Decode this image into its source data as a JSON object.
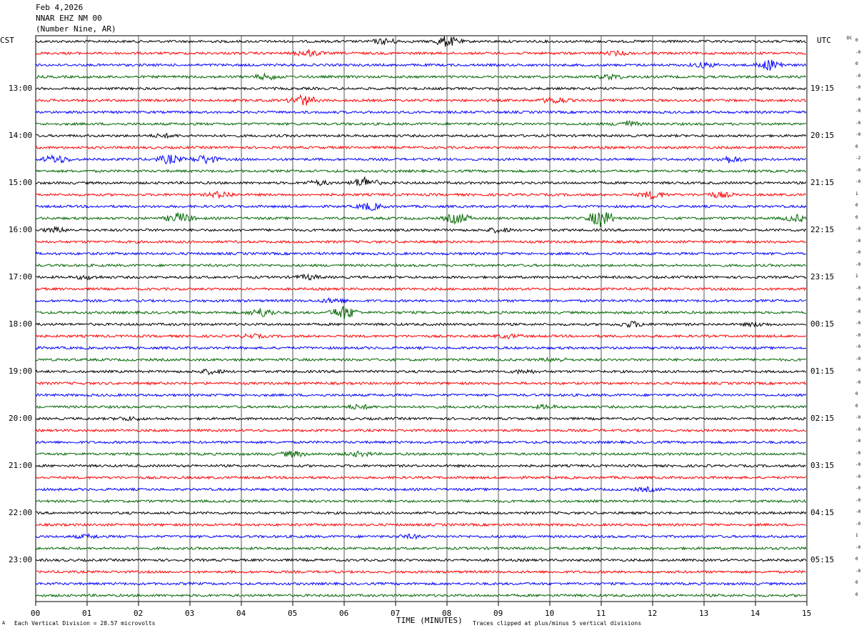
{
  "header": {
    "date": "Feb 4,2026",
    "station": "NNAR EHZ NM 00",
    "location": "(Number Nine, AR)"
  },
  "left_tz": "CST",
  "right_tz": "UTC",
  "dc_label": "DC",
  "footer": {
    "left": "Each Vertical Division =   28.57 microvolts",
    "right": "Traces clipped at plus/minus 5 vertical divisions",
    "corner": "A"
  },
  "chart_data": {
    "type": "line",
    "title": "",
    "xlabel": "TIME (MINUTES)",
    "xlim": [
      0,
      15
    ],
    "x_ticks": [
      "00",
      "01",
      "02",
      "03",
      "04",
      "05",
      "06",
      "07",
      "08",
      "09",
      "10",
      "11",
      "12",
      "13",
      "14",
      "15"
    ],
    "trace_count": 48,
    "trace_interval_minutes": 15,
    "trace_colors": [
      "#000000",
      "#ff0000",
      "#0000ff",
      "#006600"
    ],
    "left_time_labels": [
      {
        "trace": 4,
        "label": "13:00"
      },
      {
        "trace": 8,
        "label": "14:00"
      },
      {
        "trace": 12,
        "label": "15:00"
      },
      {
        "trace": 16,
        "label": "16:00"
      },
      {
        "trace": 20,
        "label": "17:00"
      },
      {
        "trace": 24,
        "label": "18:00"
      },
      {
        "trace": 28,
        "label": "19:00"
      },
      {
        "trace": 32,
        "label": "20:00"
      },
      {
        "trace": 36,
        "label": "21:00"
      },
      {
        "trace": 40,
        "label": "22:00"
      },
      {
        "trace": 44,
        "label": "23:00"
      }
    ],
    "right_time_labels": [
      {
        "trace": 4,
        "label": "19:15"
      },
      {
        "trace": 8,
        "label": "20:15"
      },
      {
        "trace": 12,
        "label": "21:15"
      },
      {
        "trace": 16,
        "label": "22:15"
      },
      {
        "trace": 20,
        "label": "23:15"
      },
      {
        "trace": 24,
        "label": "00:15"
      },
      {
        "trace": 28,
        "label": "01:15"
      },
      {
        "trace": 32,
        "label": "02:15"
      },
      {
        "trace": 36,
        "label": "03:15"
      },
      {
        "trace": 40,
        "label": "04:15"
      },
      {
        "trace": 44,
        "label": "05:15"
      }
    ],
    "dc_offsets": [
      "0",
      "-0",
      "0",
      "-0",
      "-0",
      "-0",
      "-0",
      "-0",
      "-0",
      "0",
      "-2",
      "-0",
      "-0",
      "1",
      "0",
      "0",
      "-0",
      "-0",
      "-0",
      "-0",
      "1",
      "-0",
      "-0",
      "-0",
      "-0",
      "-0",
      "-0",
      "-0",
      "-0",
      "-0",
      "0",
      "0",
      "-0",
      "-0",
      "-0",
      "-0",
      "-0",
      "-0",
      "-0",
      "-0",
      "-0",
      "-0",
      "1",
      "-0",
      "0",
      "-0",
      "0",
      "0"
    ],
    "events": [
      {
        "trace": 0,
        "minute": 8.0,
        "amp": 1.0
      },
      {
        "trace": 0,
        "minute": 6.8,
        "amp": 0.5
      },
      {
        "trace": 1,
        "minute": 5.3,
        "amp": 0.6
      },
      {
        "trace": 1,
        "minute": 11.3,
        "amp": 0.3
      },
      {
        "trace": 2,
        "minute": 14.3,
        "amp": 1.0
      },
      {
        "trace": 2,
        "minute": 13.0,
        "amp": 0.4
      },
      {
        "trace": 3,
        "minute": 4.5,
        "amp": 0.5
      },
      {
        "trace": 3,
        "minute": 11.2,
        "amp": 0.4
      },
      {
        "trace": 5,
        "minute": 5.2,
        "amp": 1.0
      },
      {
        "trace": 5,
        "minute": 10.1,
        "amp": 0.6
      },
      {
        "trace": 7,
        "minute": 11.5,
        "amp": 0.5
      },
      {
        "trace": 8,
        "minute": 2.5,
        "amp": 0.3
      },
      {
        "trace": 10,
        "minute": 0.4,
        "amp": 0.8
      },
      {
        "trace": 10,
        "minute": 2.6,
        "amp": 0.8
      },
      {
        "trace": 10,
        "minute": 3.3,
        "amp": 0.8
      },
      {
        "trace": 10,
        "minute": 13.5,
        "amp": 0.6
      },
      {
        "trace": 12,
        "minute": 6.4,
        "amp": 1.0
      },
      {
        "trace": 12,
        "minute": 5.5,
        "amp": 0.4
      },
      {
        "trace": 13,
        "minute": 3.6,
        "amp": 0.6
      },
      {
        "trace": 13,
        "minute": 12.0,
        "amp": 0.7
      },
      {
        "trace": 13,
        "minute": 13.3,
        "amp": 0.5
      },
      {
        "trace": 14,
        "minute": 6.5,
        "amp": 0.7
      },
      {
        "trace": 15,
        "minute": 2.8,
        "amp": 1.0
      },
      {
        "trace": 15,
        "minute": 8.2,
        "amp": 1.0
      },
      {
        "trace": 15,
        "minute": 11.0,
        "amp": 1.6
      },
      {
        "trace": 15,
        "minute": 14.8,
        "amp": 0.6
      },
      {
        "trace": 16,
        "minute": 0.4,
        "amp": 0.4
      },
      {
        "trace": 16,
        "minute": 9.0,
        "amp": 0.4
      },
      {
        "trace": 20,
        "minute": 1.0,
        "amp": 0.3
      },
      {
        "trace": 20,
        "minute": 5.3,
        "amp": 0.4
      },
      {
        "trace": 22,
        "minute": 5.8,
        "amp": 0.4
      },
      {
        "trace": 23,
        "minute": 4.4,
        "amp": 0.8
      },
      {
        "trace": 23,
        "minute": 6.0,
        "amp": 1.3
      },
      {
        "trace": 24,
        "minute": 11.6,
        "amp": 0.5
      },
      {
        "trace": 24,
        "minute": 14.0,
        "amp": 0.3
      },
      {
        "trace": 25,
        "minute": 4.2,
        "amp": 0.3
      },
      {
        "trace": 25,
        "minute": 9.2,
        "amp": 0.3
      },
      {
        "trace": 27,
        "minute": 10.1,
        "amp": 0.3
      },
      {
        "trace": 28,
        "minute": 3.4,
        "amp": 0.4
      },
      {
        "trace": 28,
        "minute": 9.5,
        "amp": 0.3
      },
      {
        "trace": 31,
        "minute": 6.3,
        "amp": 0.4
      },
      {
        "trace": 31,
        "minute": 9.9,
        "amp": 0.3
      },
      {
        "trace": 32,
        "minute": 1.8,
        "amp": 0.3
      },
      {
        "trace": 35,
        "minute": 5.0,
        "amp": 0.5
      },
      {
        "trace": 35,
        "minute": 6.3,
        "amp": 0.4
      },
      {
        "trace": 38,
        "minute": 11.9,
        "amp": 0.3
      },
      {
        "trace": 42,
        "minute": 1.0,
        "amp": 0.3
      },
      {
        "trace": 42,
        "minute": 7.3,
        "amp": 0.3
      }
    ]
  }
}
